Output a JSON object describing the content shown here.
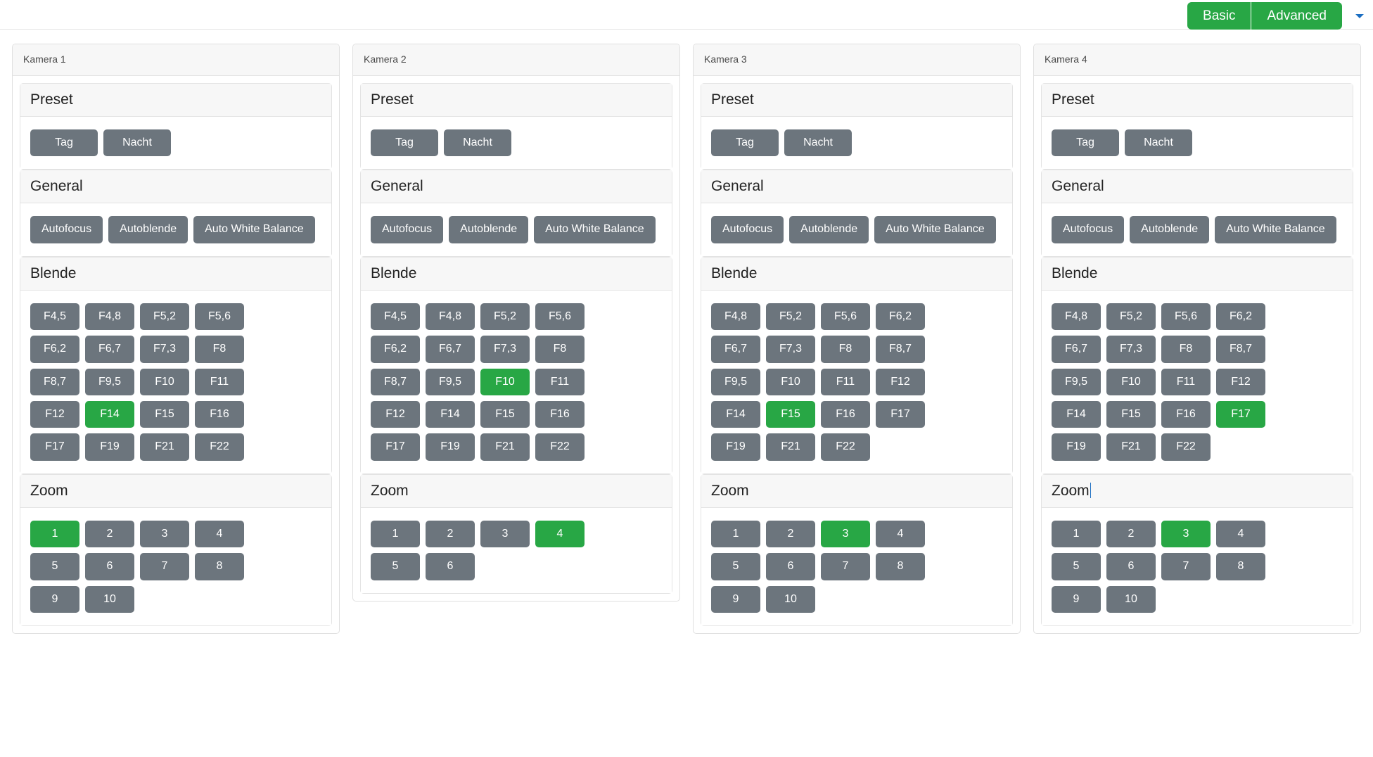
{
  "topbar": {
    "mode_buttons": [
      {
        "label": "Basic",
        "active": true
      },
      {
        "label": "Advanced",
        "active": true
      }
    ],
    "accent_color": "#28a745",
    "caret_icon": "chevron-down-icon"
  },
  "colors": {
    "button_default": "#6c757d",
    "button_active": "#28a745",
    "panel_header_bg": "#f7f7f7",
    "border": "#e3e3e3"
  },
  "section_titles": {
    "preset": "Preset",
    "general": "General",
    "blende": "Blende",
    "zoom": "Zoom"
  },
  "cameras": [
    {
      "title": "Kamera 1",
      "preset": {
        "title": "Preset",
        "buttons": [
          "Tag",
          "Nacht"
        ]
      },
      "general": {
        "title": "General",
        "buttons": [
          "Autofocus",
          "Autoblende",
          "Auto White Balance"
        ]
      },
      "blende": {
        "title": "Blende",
        "buttons": [
          "F4,5",
          "F4,8",
          "F5,2",
          "F5,6",
          "F6,2",
          "F6,7",
          "F7,3",
          "F8",
          "F8,7",
          "F9,5",
          "F10",
          "F11",
          "F12",
          "F14",
          "F15",
          "F16",
          "F17",
          "F19",
          "F21",
          "F22"
        ],
        "selected": "F14"
      },
      "zoom": {
        "title": "Zoom",
        "title_has_caret": false,
        "buttons": [
          "1",
          "2",
          "3",
          "4",
          "5",
          "6",
          "7",
          "8",
          "9",
          "10"
        ],
        "selected": "1"
      }
    },
    {
      "title": "Kamera 2",
      "preset": {
        "title": "Preset",
        "buttons": [
          "Tag",
          "Nacht"
        ]
      },
      "general": {
        "title": "General",
        "buttons": [
          "Autofocus",
          "Autoblende",
          "Auto White Balance"
        ]
      },
      "blende": {
        "title": "Blende",
        "buttons": [
          "F4,5",
          "F4,8",
          "F5,2",
          "F5,6",
          "F6,2",
          "F6,7",
          "F7,3",
          "F8",
          "F8,7",
          "F9,5",
          "F10",
          "F11",
          "F12",
          "F14",
          "F15",
          "F16",
          "F17",
          "F19",
          "F21",
          "F22"
        ],
        "selected": "F10"
      },
      "zoom": {
        "title": "Zoom",
        "title_has_caret": false,
        "buttons": [
          "1",
          "2",
          "3",
          "4",
          "5",
          "6"
        ],
        "selected": "4"
      }
    },
    {
      "title": "Kamera 3",
      "preset": {
        "title": "Preset",
        "buttons": [
          "Tag",
          "Nacht"
        ]
      },
      "general": {
        "title": "General",
        "buttons": [
          "Autofocus",
          "Autoblende",
          "Auto White Balance"
        ]
      },
      "blende": {
        "title": "Blende",
        "buttons": [
          "F4,8",
          "F5,2",
          "F5,6",
          "F6,2",
          "F6,7",
          "F7,3",
          "F8",
          "F8,7",
          "F9,5",
          "F10",
          "F11",
          "F12",
          "F14",
          "F15",
          "F16",
          "F17",
          "F19",
          "F21",
          "F22"
        ],
        "selected": "F15"
      },
      "zoom": {
        "title": "Zoom",
        "title_has_caret": false,
        "buttons": [
          "1",
          "2",
          "3",
          "4",
          "5",
          "6",
          "7",
          "8",
          "9",
          "10"
        ],
        "selected": "3"
      }
    },
    {
      "title": "Kamera 4",
      "preset": {
        "title": "Preset",
        "buttons": [
          "Tag",
          "Nacht"
        ]
      },
      "general": {
        "title": "General",
        "buttons": [
          "Autofocus",
          "Autoblende",
          "Auto White Balance"
        ]
      },
      "blende": {
        "title": "Blende",
        "buttons": [
          "F4,8",
          "F5,2",
          "F5,6",
          "F6,2",
          "F6,7",
          "F7,3",
          "F8",
          "F8,7",
          "F9,5",
          "F10",
          "F11",
          "F12",
          "F14",
          "F15",
          "F16",
          "F17",
          "F19",
          "F21",
          "F22"
        ],
        "selected": "F17"
      },
      "zoom": {
        "title": "Zoom",
        "title_has_caret": true,
        "buttons": [
          "1",
          "2",
          "3",
          "4",
          "5",
          "6",
          "7",
          "8",
          "9",
          "10"
        ],
        "selected": "3"
      }
    }
  ]
}
